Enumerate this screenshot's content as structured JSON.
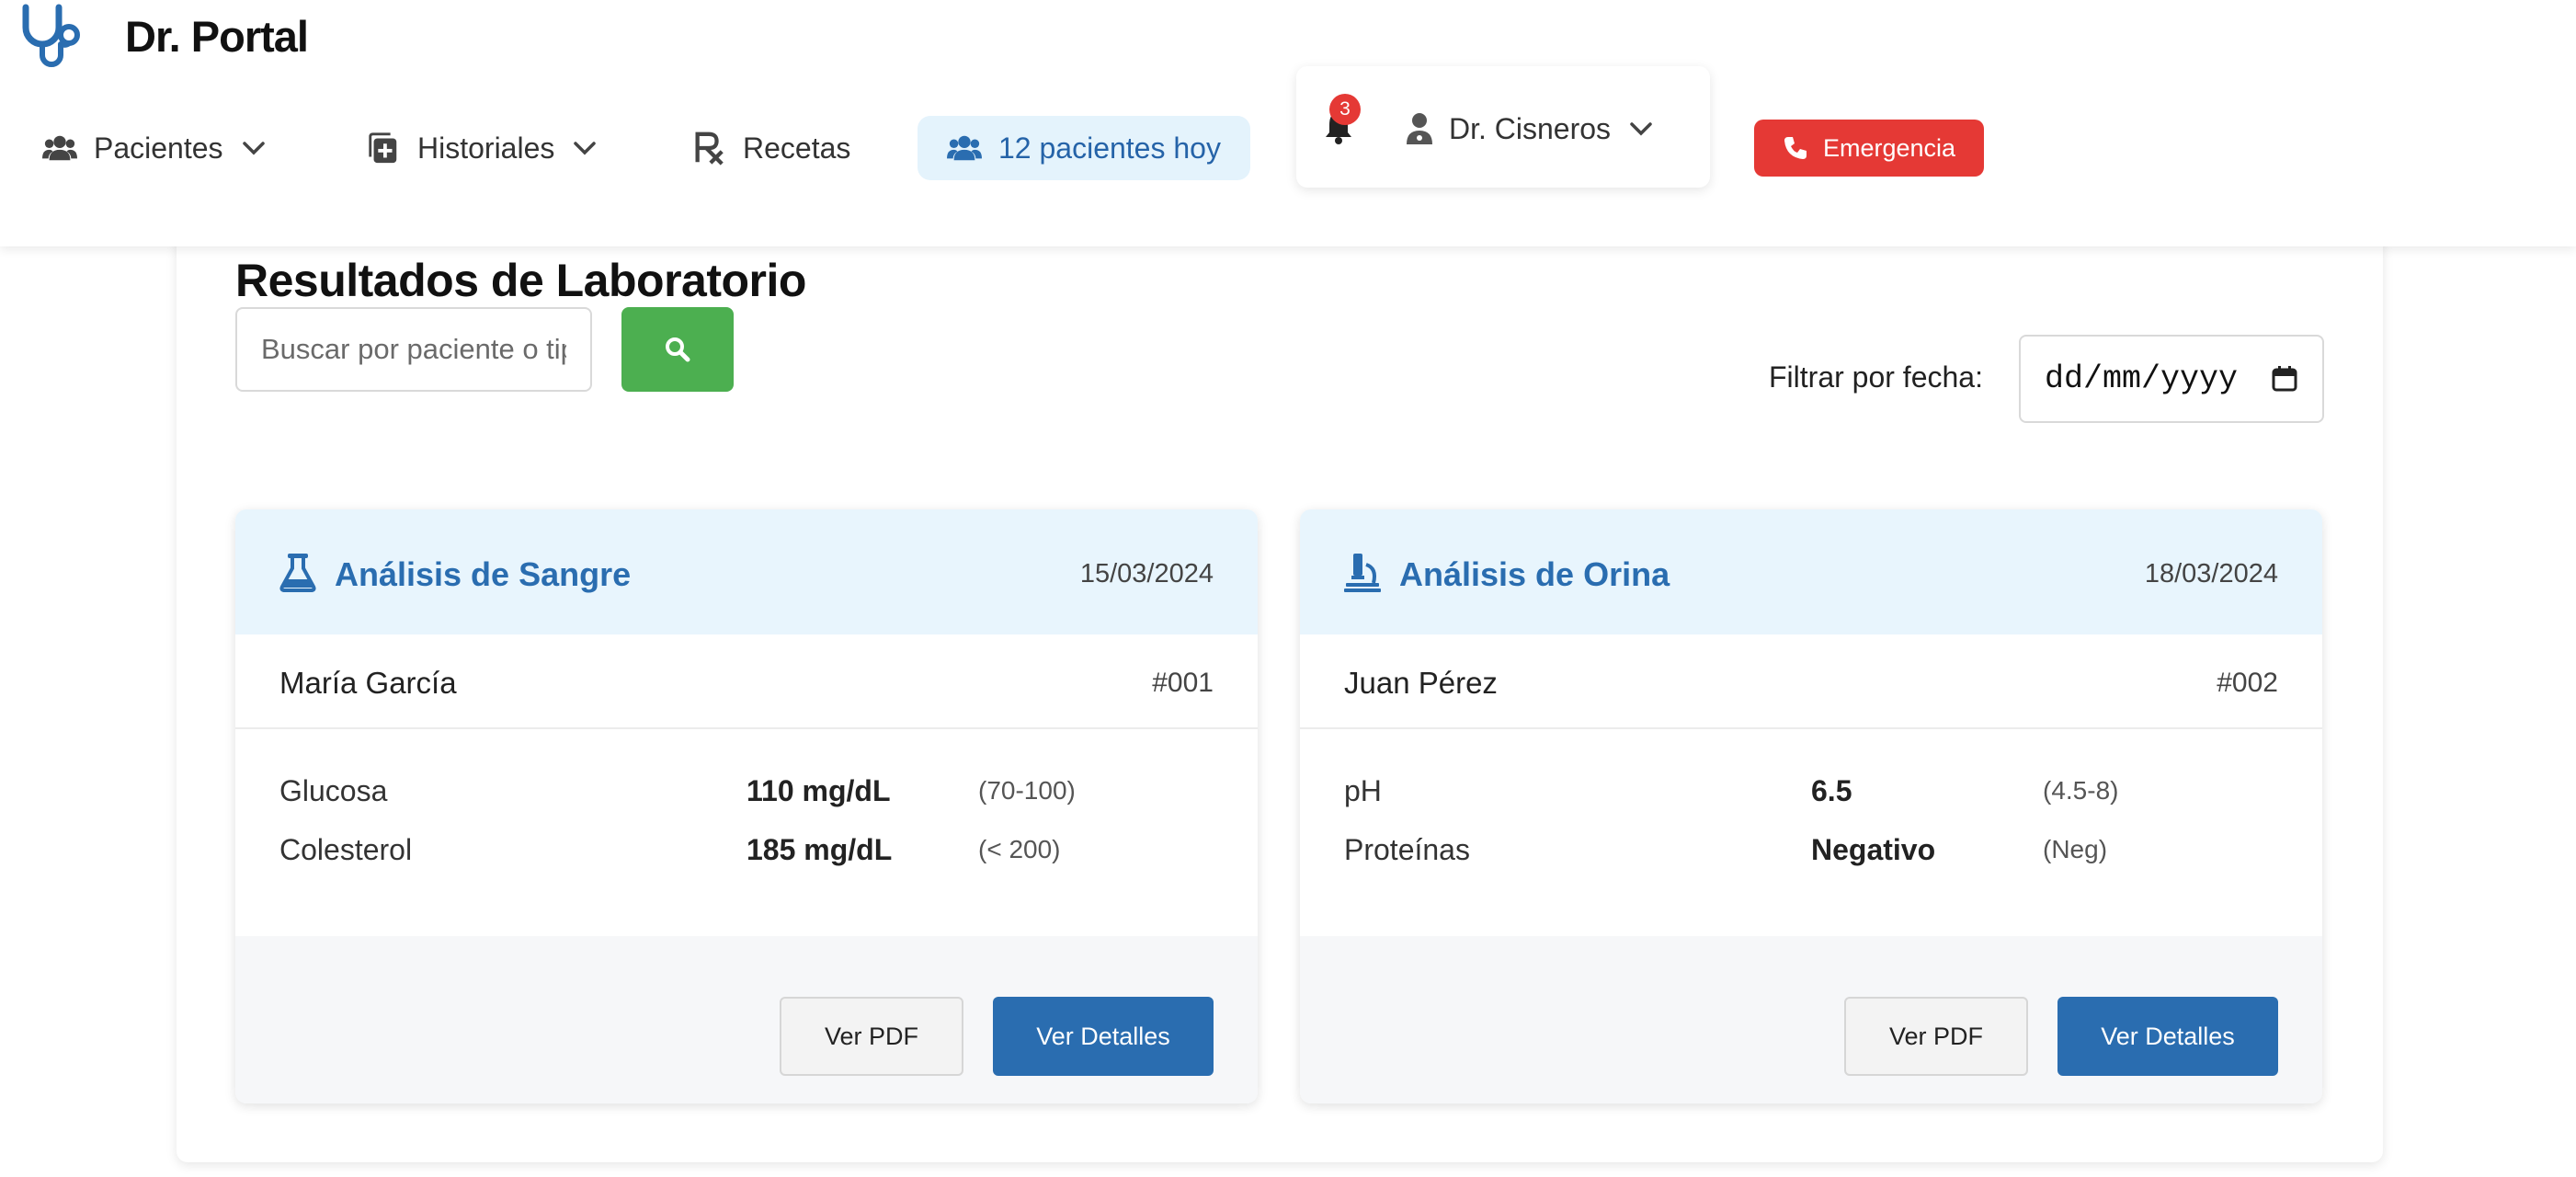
{
  "app": {
    "title": "Dr. Portal"
  },
  "nav": {
    "items": [
      {
        "label": "Pacientes",
        "icon": "users-icon",
        "has_dropdown": true
      },
      {
        "label": "Historiales",
        "icon": "file-medical-icon",
        "has_dropdown": true
      },
      {
        "label": "Recetas",
        "icon": "prescription-icon",
        "has_dropdown": false
      }
    ],
    "patients_today": "12 pacientes hoy"
  },
  "notifications": {
    "count": "3"
  },
  "user": {
    "name": "Dr. Cisneros"
  },
  "emergency": {
    "label": "Emergencia"
  },
  "page": {
    "title": "Resultados de Laboratorio",
    "search_placeholder": "Buscar por paciente o tipo de análisis",
    "filter_label": "Filtrar por fecha:",
    "date_placeholder": "dd/mm/yyyy"
  },
  "cards": [
    {
      "icon": "flask-icon",
      "title": "Análisis de Sangre",
      "date": "15/03/2024",
      "patient": "María García",
      "id": "#001",
      "results": [
        {
          "name": "Glucosa",
          "value": "110 mg/dL",
          "range": "(70-100)"
        },
        {
          "name": "Colesterol",
          "value": "185 mg/dL",
          "range": "(< 200)"
        }
      ],
      "pdf_label": "Ver PDF",
      "details_label": "Ver Detalles"
    },
    {
      "icon": "microscope-icon",
      "title": "Análisis de Orina",
      "date": "18/03/2024",
      "patient": "Juan Pérez",
      "id": "#002",
      "results": [
        {
          "name": "pH",
          "value": "6.5",
          "range": "(4.5-8)"
        },
        {
          "name": "Proteínas",
          "value": "Negativo",
          "range": "(Neg)"
        }
      ],
      "pdf_label": "Ver PDF",
      "details_label": "Ver Detalles"
    }
  ],
  "colors": {
    "brand": "#2a6db0",
    "emergency": "#e53935",
    "search_button": "#4caf50",
    "card_header": "#e8f5fd"
  }
}
